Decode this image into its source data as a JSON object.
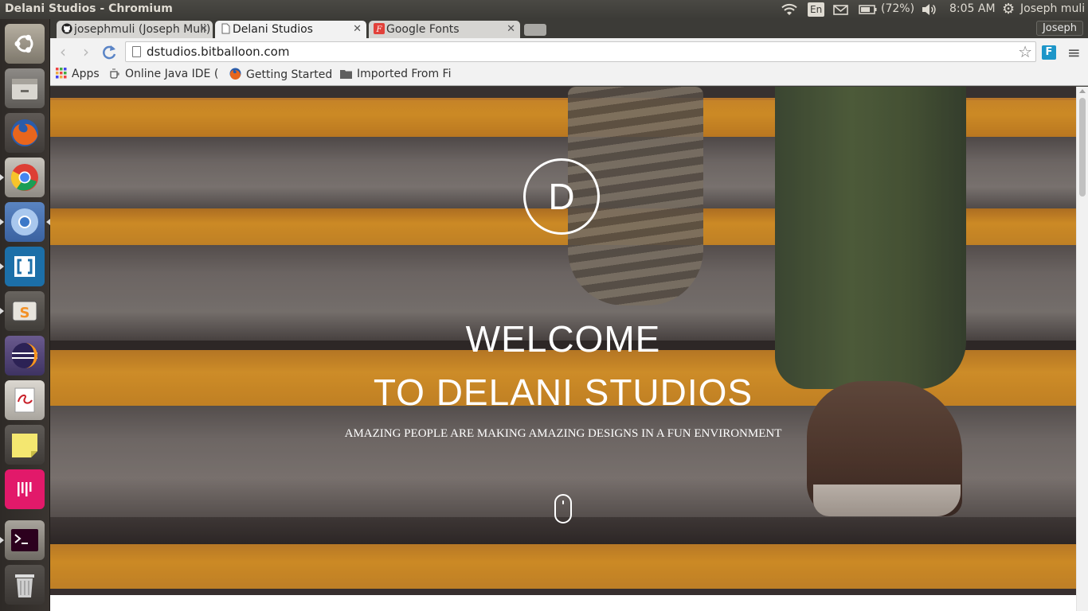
{
  "window": {
    "title": "Delani Studios - Chromium"
  },
  "system_tray": {
    "keyboard_layout": "En",
    "battery": "(72%)",
    "time": "8:05 AM",
    "user": "Joseph muli"
  },
  "launcher": {
    "items": [
      "ubuntu-dash",
      "files",
      "firefox",
      "chrome",
      "chromium",
      "brackets",
      "sublime-text",
      "eclipse",
      "evince",
      "sticky-notes",
      "gitkraken",
      "terminal",
      "trash"
    ]
  },
  "browser": {
    "tabs": [
      {
        "label": "josephmuli (Joseph Muli)",
        "active": false
      },
      {
        "label": "Delani Studios",
        "active": true
      },
      {
        "label": "Google Fonts",
        "active": false
      }
    ],
    "profile": "Joseph",
    "url": "dstudios.bitballoon.com",
    "bookmarks": [
      {
        "label": "Apps"
      },
      {
        "label": "Online Java IDE ("
      },
      {
        "label": "Getting Started"
      },
      {
        "label": "Imported From Fi"
      }
    ]
  },
  "page": {
    "logo_letter": "D",
    "title_line1": "WELCOME",
    "title_line2": "TO DELANI STUDIOS",
    "subtitle": "AMAZING PEOPLE ARE MAKING AMAZING DESIGNS IN A FUN ENVIRONMENT"
  },
  "colors": {
    "stripe_orange": "#f0a226",
    "step_gray": "#6f6a66",
    "panel_bg": "#3c3b37",
    "tab_active": "#f2f2f2",
    "tab_inactive": "#d6d5d2"
  }
}
